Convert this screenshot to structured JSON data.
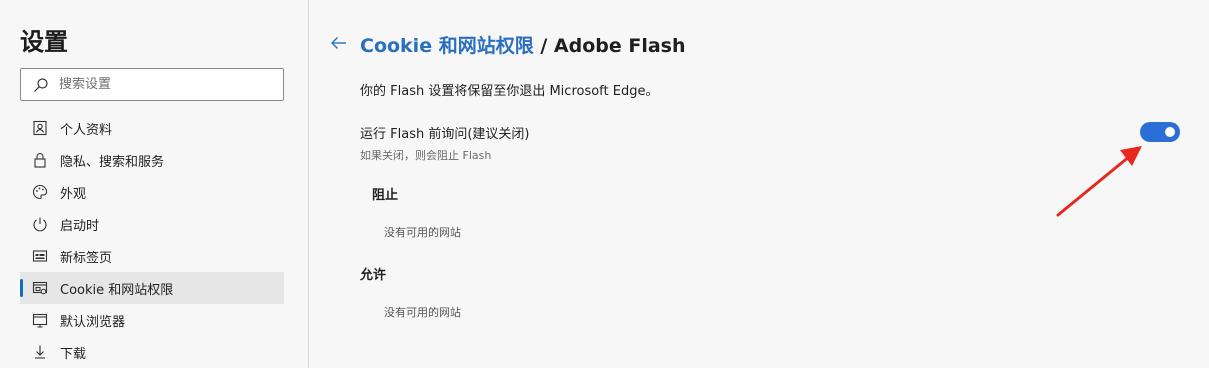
{
  "sidebar": {
    "title": "设置",
    "search": {
      "placeholder": "搜索设置",
      "value": ""
    },
    "items": [
      {
        "label": "个人资料",
        "icon": "profile-icon",
        "active": false
      },
      {
        "label": "隐私、搜索和服务",
        "icon": "lock-icon",
        "active": false
      },
      {
        "label": "外观",
        "icon": "palette-icon",
        "active": false
      },
      {
        "label": "启动时",
        "icon": "power-icon",
        "active": false
      },
      {
        "label": "新标签页",
        "icon": "new-tab-icon",
        "active": false
      },
      {
        "label": "Cookie 和网站权限",
        "icon": "site-permissions-icon",
        "active": true
      },
      {
        "label": "默认浏览器",
        "icon": "browser-icon",
        "active": false
      },
      {
        "label": "下载",
        "icon": "download-icon",
        "active": false
      }
    ]
  },
  "header": {
    "breadcrumb": "Cookie 和网站权限",
    "separator": "/",
    "current": "Adobe Flash"
  },
  "main": {
    "description": "你的 Flash 设置将保留至你退出 Microsoft Edge。",
    "setting": {
      "label": "运行 Flash 前询问(建议关闭)",
      "sublabel": "如果关闭，则会阻止 Flash",
      "enabled": true
    },
    "block": {
      "title": "阻止",
      "empty": "没有可用的网站"
    },
    "allow": {
      "title": "允许",
      "empty": "没有可用的网站"
    }
  },
  "colors": {
    "accent": "#2b6fd6",
    "breadcrumb": "#2a6fbe",
    "annotation": "#e8281f"
  }
}
